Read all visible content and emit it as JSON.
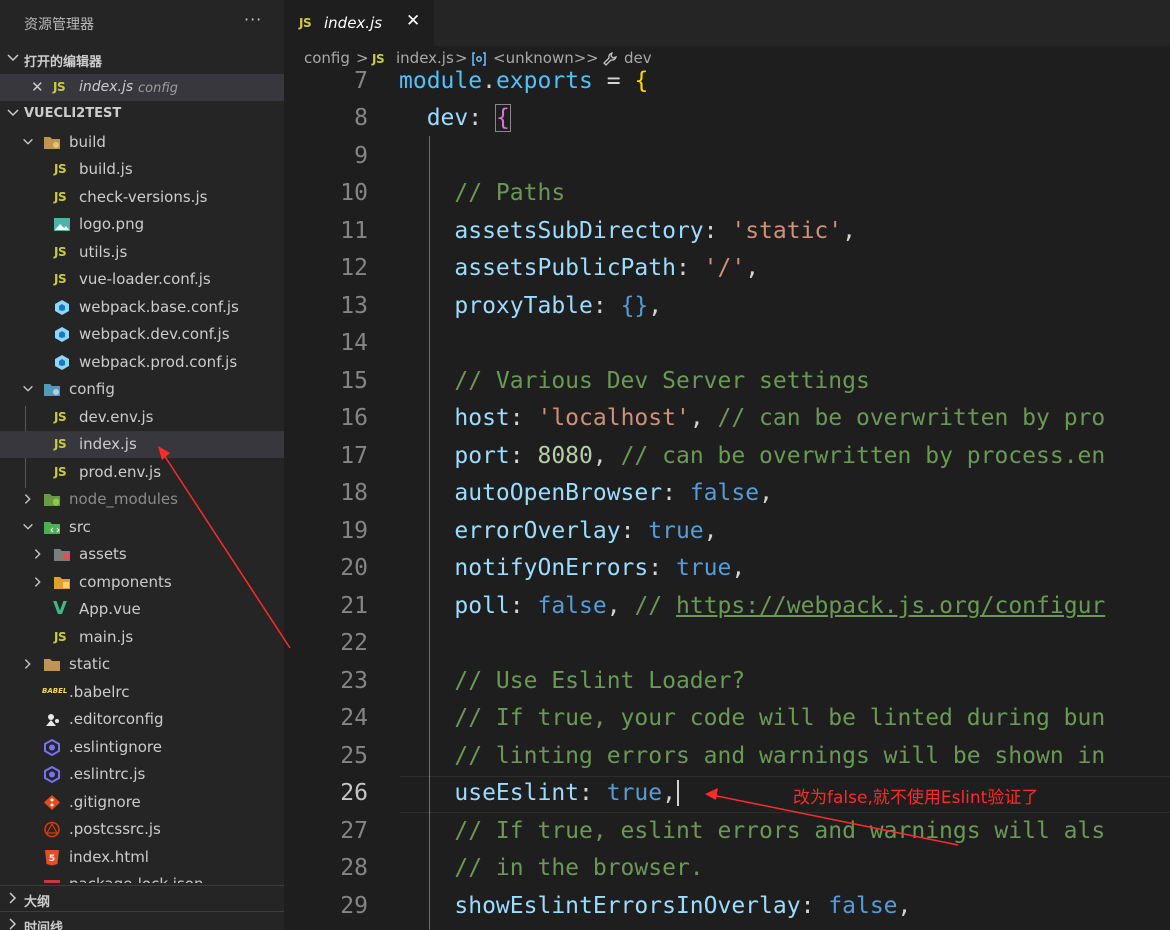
{
  "sidebar": {
    "title": "资源管理器",
    "more": "···",
    "open_editors_label": "打开的编辑器",
    "open_editor": {
      "close": "✕",
      "badge": "JS",
      "name": "index.js",
      "dir": "config"
    },
    "project_label": "VUECLI2TEST",
    "tree": [
      {
        "name": "build",
        "icon": "folder-build-icon"
      },
      {
        "name": "build.js",
        "icon": "js-file-icon",
        "badge": "JS"
      },
      {
        "name": "check-versions.js",
        "icon": "js-file-icon",
        "badge": "JS"
      },
      {
        "name": "logo.png",
        "icon": "image-file-icon"
      },
      {
        "name": "utils.js",
        "icon": "js-file-icon",
        "badge": "JS"
      },
      {
        "name": "vue-loader.conf.js",
        "icon": "js-file-icon",
        "badge": "JS"
      },
      {
        "name": "webpack.base.conf.js",
        "icon": "webpack-icon"
      },
      {
        "name": "webpack.dev.conf.js",
        "icon": "webpack-icon"
      },
      {
        "name": "webpack.prod.conf.js",
        "icon": "webpack-icon"
      },
      {
        "name": "config",
        "icon": "folder-config-icon"
      },
      {
        "name": "dev.env.js",
        "icon": "js-file-icon",
        "badge": "JS"
      },
      {
        "name": "index.js",
        "icon": "js-file-icon",
        "badge": "JS"
      },
      {
        "name": "prod.env.js",
        "icon": "js-file-icon",
        "badge": "JS"
      },
      {
        "name": "node_modules",
        "icon": "folder-node-icon"
      },
      {
        "name": "src",
        "icon": "folder-src-icon"
      },
      {
        "name": "assets",
        "icon": "folder-assets-icon"
      },
      {
        "name": "components",
        "icon": "folder-components-icon"
      },
      {
        "name": "App.vue",
        "icon": "vue-icon",
        "badge": "V"
      },
      {
        "name": "main.js",
        "icon": "js-file-icon",
        "badge": "JS"
      },
      {
        "name": "static",
        "icon": "folder-static-icon"
      },
      {
        "name": ".babelrc",
        "icon": "babel-icon",
        "badge": "BABEL"
      },
      {
        "name": ".editorconfig",
        "icon": "editorconfig-icon"
      },
      {
        "name": ".eslintignore",
        "icon": "eslint-icon"
      },
      {
        "name": ".eslintrc.js",
        "icon": "eslint-icon"
      },
      {
        "name": ".gitignore",
        "icon": "git-icon"
      },
      {
        "name": ".postcssrc.js",
        "icon": "postcss-icon"
      },
      {
        "name": "index.html",
        "icon": "html-icon",
        "badge": "5"
      },
      {
        "name": "package-lock.json",
        "icon": "npm-icon"
      }
    ],
    "outline_label": "大纲",
    "timeline_label": "时间线"
  },
  "tab": {
    "badge": "JS",
    "name": "index.js",
    "close": "✕"
  },
  "breadcrumb": {
    "folder": "config",
    "sep": ">",
    "file_badge": "JS",
    "file": "index.js",
    "symbol": "<unknown>",
    "property": "dev"
  },
  "editor": {
    "line_numbers": [
      "7",
      "8",
      "9",
      "10",
      "11",
      "12",
      "13",
      "14",
      "15",
      "16",
      "17",
      "18",
      "19",
      "20",
      "21",
      "22",
      "23",
      "24",
      "25",
      "26",
      "27",
      "28",
      "29"
    ],
    "active_line": "26",
    "tokens": {
      "module": "module",
      "exports": "exports",
      "dev": "dev",
      "c_paths": "// Paths",
      "assetsSubDirectory": "assetsSubDirectory",
      "static_str": "'static'",
      "assetsPublicPath": "assetsPublicPath",
      "slash_str": "'/'",
      "proxyTable": "proxyTable",
      "c_various": "// Various Dev Server settings",
      "host": "host",
      "localhost_str": "'localhost'",
      "c_host": "// can be overwritten by pro",
      "port": "port",
      "port_val": "8080",
      "c_port": "// can be overwritten by process.en",
      "autoOpenBrowser": "autoOpenBrowser",
      "false": "false",
      "true": "true",
      "errorOverlay": "errorOverlay",
      "notifyOnErrors": "notifyOnErrors",
      "poll": "poll",
      "c_slash": "//",
      "poll_url": "https://webpack.js.org/configur",
      "c_eslint": "// Use Eslint Loader?",
      "c_iftrue": "// If true, your code will be linted during bun",
      "c_linting": "// linting errors and warnings will be shown in",
      "useEslint": "useEslint",
      "c_iftrue2": "// If true, eslint errors and warnings will als",
      "c_browser": "// in the browser.",
      "showEslintErrorsInOverlay": "showEslintErrorsInOverlay"
    }
  },
  "annotation": "改为false,就不使用Eslint验证了",
  "colors": {
    "annotation_red": "#ff2a2a",
    "sidebar_bg": "#252526",
    "editor_bg": "#1e1e1e",
    "selected_row": "#37373d"
  }
}
